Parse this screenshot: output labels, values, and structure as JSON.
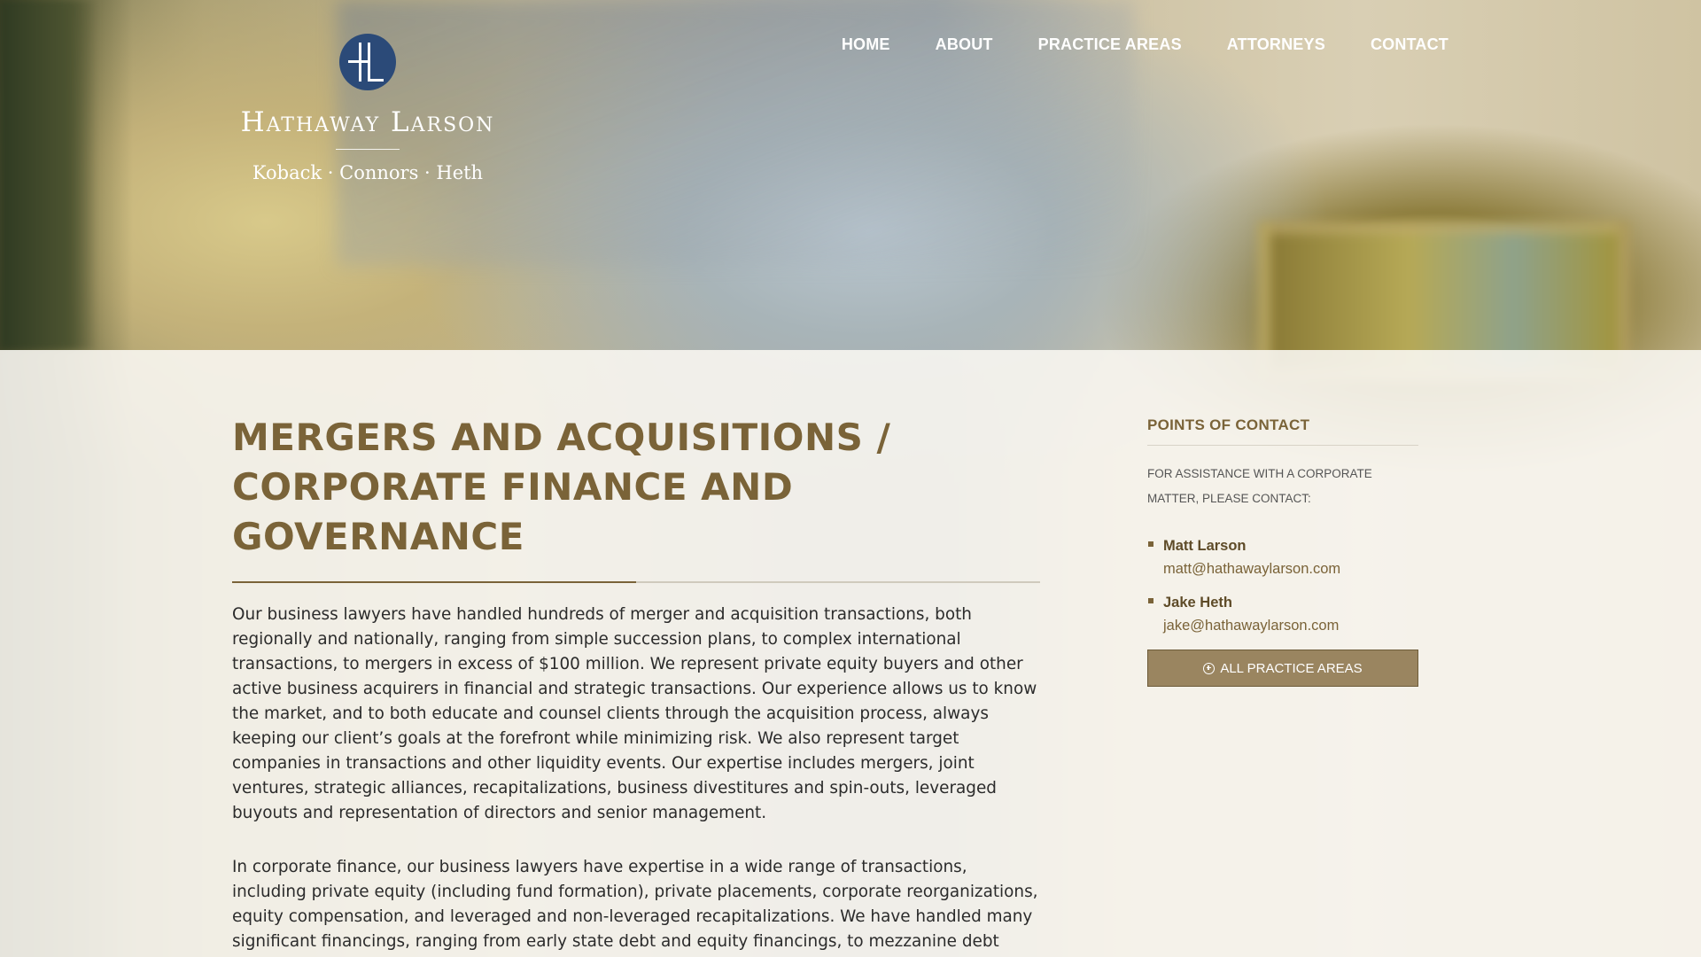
{
  "brand": {
    "name": "Hathaway Larson",
    "subtitle": "Koback · Connors · Heth",
    "mark_letters": "HL",
    "mark_color": "#2b4a78"
  },
  "nav": {
    "items": [
      {
        "label": "HOME"
      },
      {
        "label": "ABOUT"
      },
      {
        "label": "PRACTICE AREAS"
      },
      {
        "label": "ATTORNEYS"
      },
      {
        "label": "CONTACT"
      }
    ]
  },
  "main": {
    "title": "MERGERS AND ACQUISITIONS / CORPORATE FINANCE AND GOVERNANCE",
    "paragraphs": [
      "Our business lawyers have handled hundreds of merger and acquisition transactions, both regionally and nationally, ranging from simple succession plans, to complex international transactions, to mergers in excess of $100 million. We represent private equity buyers and other active business acquirers in financial and strategic transactions. Our experience allows us to know the market, and to both educate and counsel clients through the acquisition process, always keeping our client’s goals at the forefront while minimizing risk. We also represent target companies in transactions and other liquidity events. Our expertise includes mergers, joint ventures, strategic alliances, recapitalizations, business divestitures and spin-outs, leveraged buyouts and representation of directors and senior management.",
      "In corporate finance, our business lawyers have expertise in a wide range of transactions, including private equity (including fund formation), private placements, corporate reorganizations, equity compensation, and leveraged and non-leveraged recapitalizations. We have handled many significant financings, ranging from early state debt and equity financings, to mezzanine debt financings, to follow on capital raises for mature companies. In addition to issuers, we commonly represent private equity groups, developers and individual investors in investment transactions."
    ]
  },
  "sidebar": {
    "heading": "POINTS OF CONTACT",
    "intro": "FOR ASSISTANCE WITH A CORPORATE MATTER, PLEASE CONTACT:",
    "contacts": [
      {
        "name": "Matt Larson",
        "email": "matt@hathawaylarson.com"
      },
      {
        "name": "Jake Heth",
        "email": "jake@hathawaylarson.com"
      }
    ],
    "button_label": "ALL PRACTICE AREAS"
  },
  "colors": {
    "accent": "#7a6338",
    "button_bg": "#9a8560",
    "logo_blue": "#2b4a78"
  }
}
